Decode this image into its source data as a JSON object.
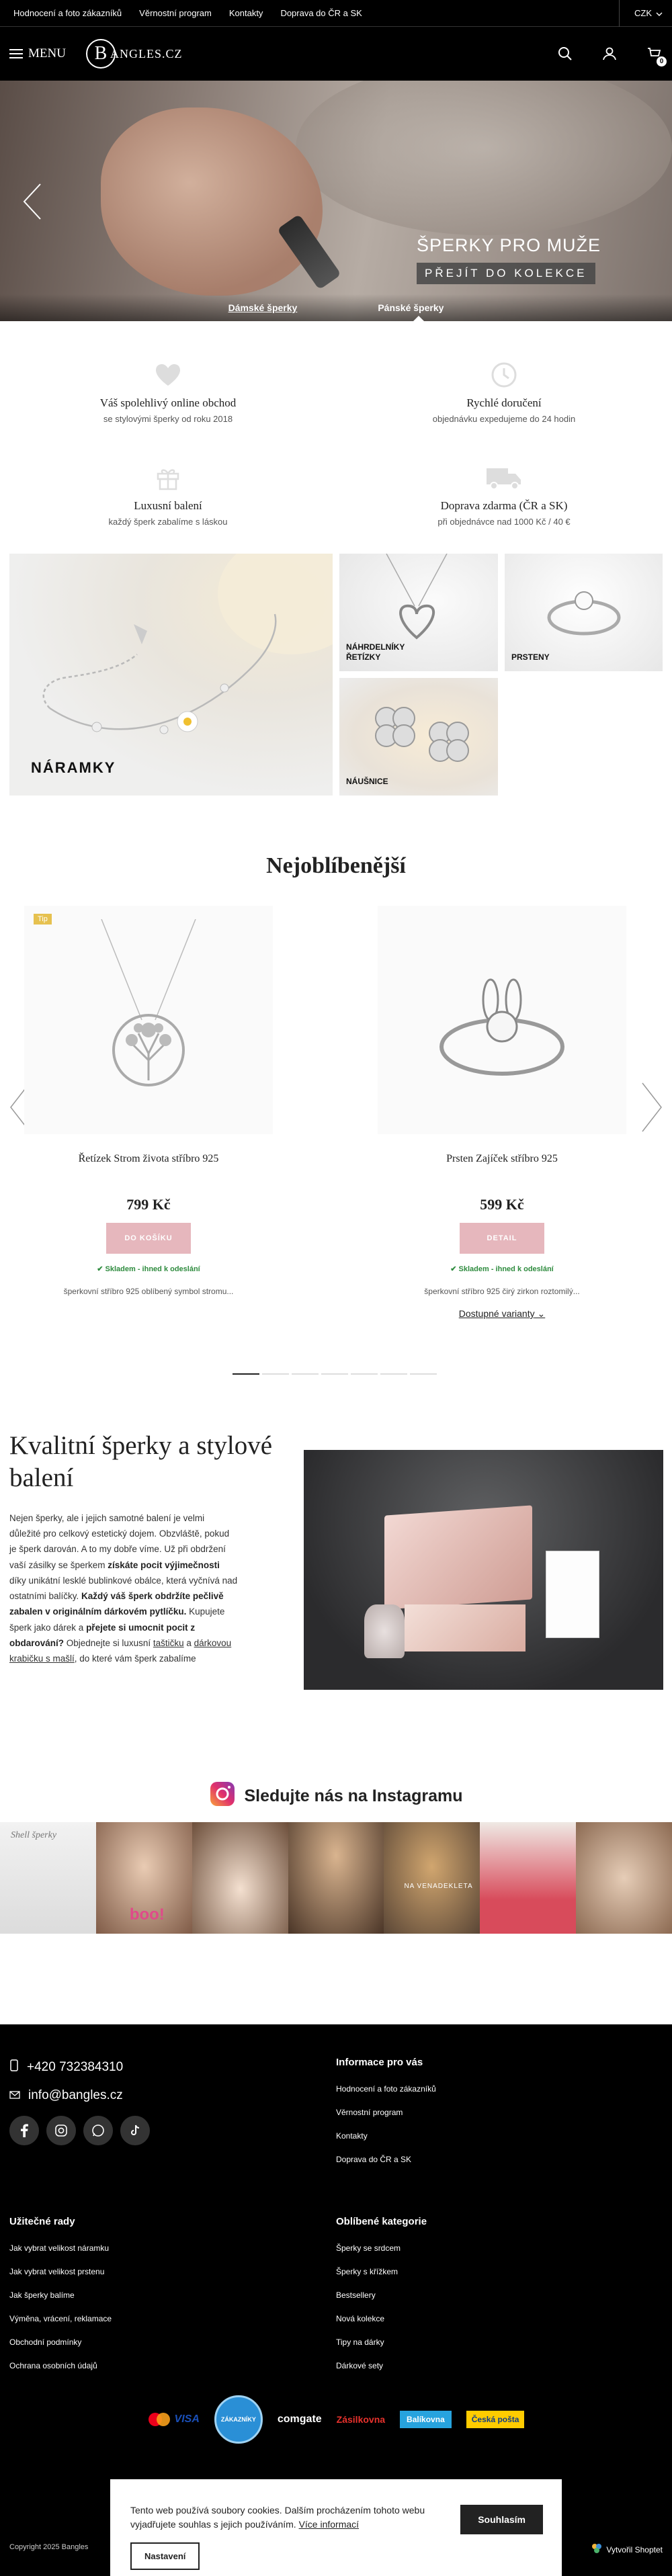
{
  "topbar": {
    "links": [
      "Hodnocení a foto zákazníků",
      "Věrnostní program",
      "Kontakty",
      "Doprava do ČR a SK"
    ],
    "currency": "CZK"
  },
  "header": {
    "menu_label": "MENU",
    "logo_letter": "B",
    "logo_text": "ANGLES.CZ",
    "cart_count": "0"
  },
  "hero": {
    "headline": "ŠPERKY PRO MUŽE",
    "cta": "PŘEJÍT DO KOLEKCE",
    "tabs": [
      "Dámské šperky",
      "Pánské šperky"
    ]
  },
  "benefits": [
    {
      "title": "Váš spolehlivý online obchod",
      "subtitle": "se stylovými šperky od roku 2018",
      "icon": "heart-icon"
    },
    {
      "title": "Rychlé doručení",
      "subtitle": "objednávku expedujeme do 24 hodin",
      "icon": "clock-icon"
    },
    {
      "title": "Luxusní balení",
      "subtitle": "každý šperk zabalíme s láskou",
      "icon": "gift-icon"
    },
    {
      "title": "Doprava zdarma (ČR a SK)",
      "subtitle": "při objednávce nad 1000 Kč / 40 €",
      "icon": "truck-icon"
    }
  ],
  "categories": {
    "bracelets": "NÁRAMKY",
    "necklaces_1": "NÁHRDELNÍKY",
    "necklaces_2": "ŘETÍZKY",
    "rings": "PRSTENY",
    "earrings": "NÁUŠNICE"
  },
  "popular": {
    "title": "Nejoblíbenější",
    "products": [
      {
        "badge": "Tip",
        "name": "Řetízek Strom života stříbro 925",
        "price": "799 Kč",
        "button": "DO KOŠÍKU",
        "stock": "Skladem - ihned k odeslání",
        "desc": "šperkovní stříbro 925 oblíbený symbol stromu..."
      },
      {
        "name": "Prsten Zajíček stříbro 925",
        "price": "599 Kč",
        "button": "DETAIL",
        "stock": "Skladem - ihned k odeslání",
        "desc": "šperkovní stříbro 925 čirý zirkon roztomilý...",
        "variants": "Dostupné varianty"
      }
    ]
  },
  "quality": {
    "title": "Kvalitní šperky a stylové balení",
    "p1": "Nejen šperky, ale i jejich samotné balení je velmi důležité pro celkový estetický dojem. Obzvláště, pokud je šperk darován. A to my dobře víme. Už při obdržení vaší zásilky se šperkem ",
    "b1": "získáte pocit výjimečnosti",
    "p2": " díky unikátní lesklé bublinkové obálce, která vyčnívá nad ostatními balíčky. ",
    "b2": "Každý váš šperk obdržíte pečlivě zabalen v originálním dárkovém pytlíčku.",
    "p3": " Kupujete šperk jako dárek a ",
    "b3": "přejete si umocnit pocit z obdarování?",
    "p4": " Objednejte si luxusní ",
    "l1": "taštičku",
    "p5": " a ",
    "l2": "dárkovou krabičku s mašlí",
    "p6": ", do které vám šperk zabalíme"
  },
  "instagram": {
    "title": "Sledujte nás na Instagramu",
    "tile_text_1": "Shell šperky",
    "tile_text_2": "boo!",
    "tile_text_3": "NA VENADEKLETA"
  },
  "footer": {
    "phone": "+420 732384310",
    "email": "info@bangles.cz",
    "info_title": "Informace pro vás",
    "info_links": [
      "Hodnocení a foto zákazníků",
      "Věrnostní program",
      "Kontakty",
      "Doprava do ČR a SK"
    ],
    "advice_title": "Užitečné rady",
    "advice_links": [
      "Jak vybrat velikost náramku",
      "Jak vybrat velikost prstenu",
      "Jak šperky balíme",
      "Výměna, vrácení, reklamace",
      "Obchodní podmínky",
      "Ochrana osobních údajů"
    ],
    "cats_title": "Oblíbené kategorie",
    "cats_links": [
      "Šperky se srdcem",
      "Šperky s křížkem",
      "Bestsellery",
      "Nová kolekce",
      "Tipy na dárky",
      "Dárkové sety"
    ],
    "payments": [
      "VISA",
      "ZÁKAZNÍKY",
      "comgate",
      "Zásilkovna",
      "Balíkovna",
      "Česká pošta"
    ],
    "copyright": "Copyright 2025 Bangles",
    "shoptet": "Vytvořil Shoptet"
  },
  "cookie": {
    "text": "Tento web používá soubory cookies. Dalším procházením tohoto webu vyjadřujete souhlas s jejich používáním. ",
    "link": "Více informací",
    "accept": "Souhlasím",
    "settings": "Nastavení"
  }
}
